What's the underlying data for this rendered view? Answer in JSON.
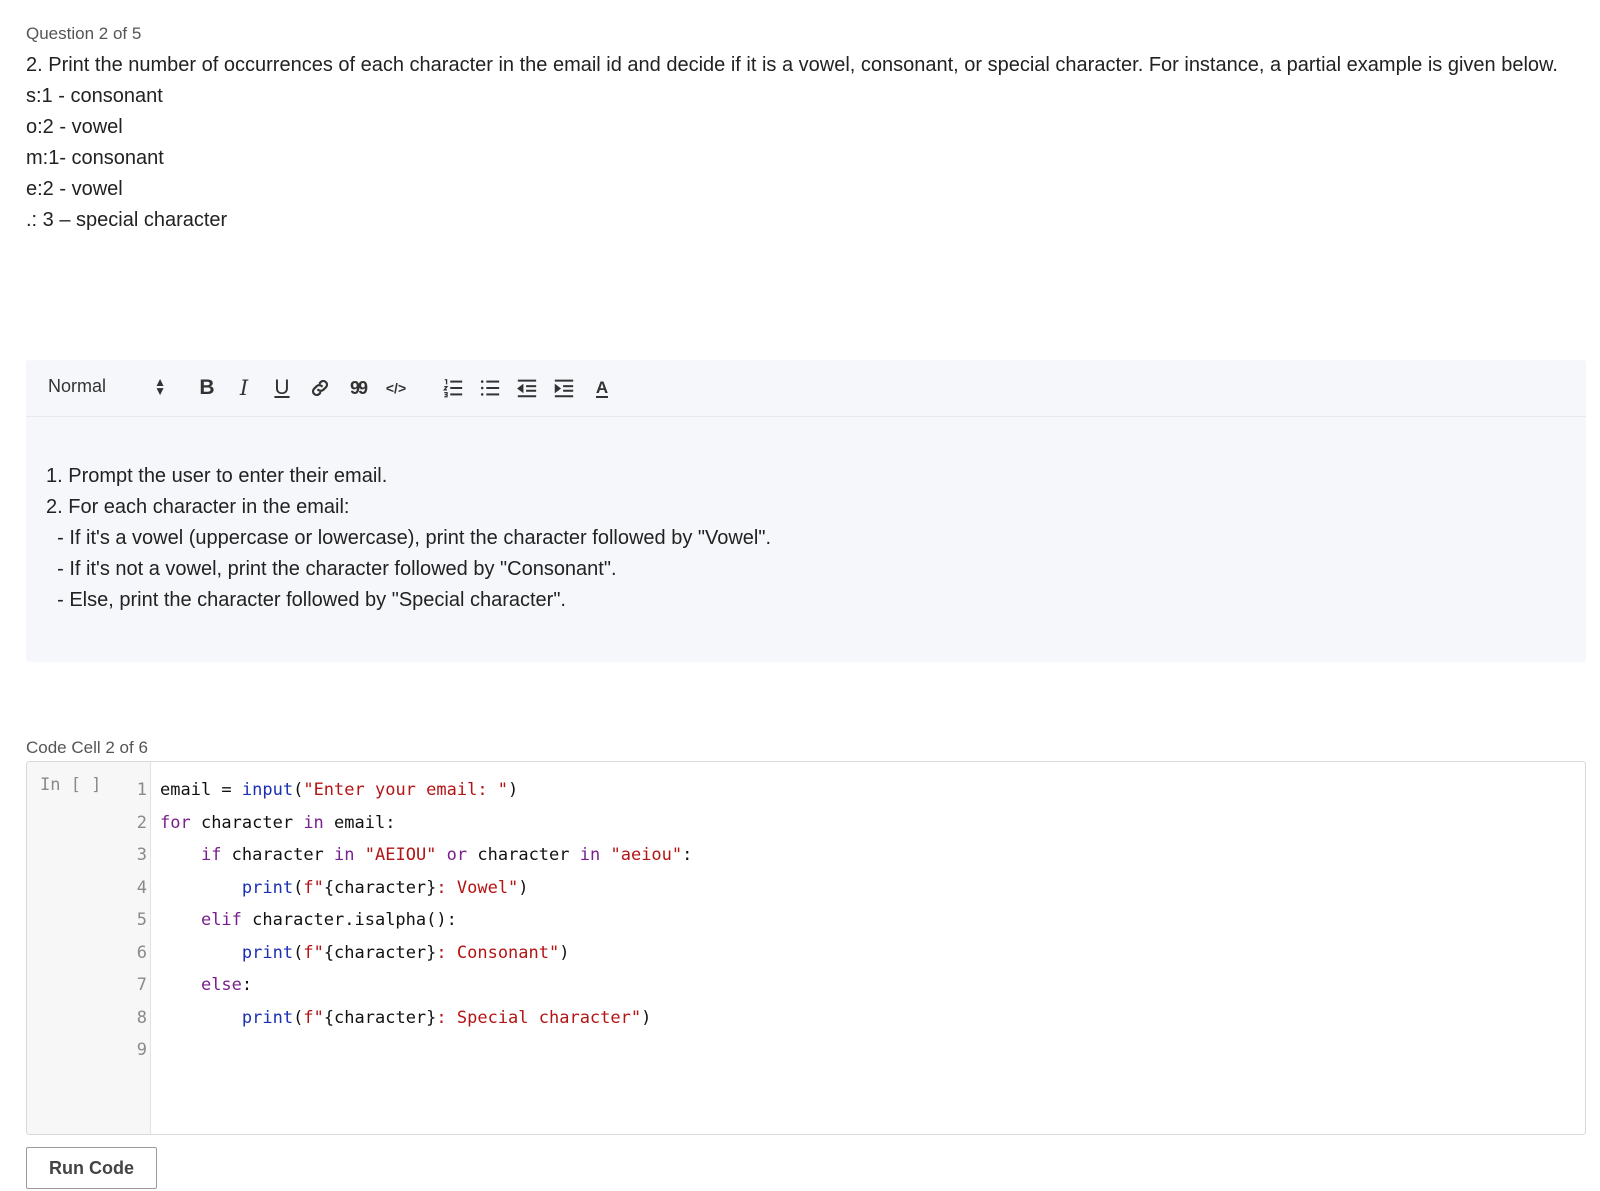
{
  "question": {
    "header": "Question 2 of 5",
    "lines": [
      "2.  Print the number of occurrences of each character in the email id and decide if it is a vowel, consonant, or special character. For instance, a partial example is given below.",
      "s:1 - consonant",
      "o:2 - vowel",
      "m:1- consonant",
      "e:2 - vowel",
      ".: 3 – special character"
    ]
  },
  "editor": {
    "format_select": "Normal",
    "toolbar_icons": [
      "bold-icon",
      "italic-icon",
      "underline-icon",
      "link-icon",
      "quote-icon",
      "code-icon",
      "ordered-list-icon",
      "bullet-list-icon",
      "outdent-icon",
      "indent-icon",
      "text-color-icon"
    ],
    "toolbar_glyphs": {
      "bold": "B",
      "italic": "I",
      "underline": "U",
      "quote": "99",
      "code": "</>",
      "color": "A"
    },
    "content": [
      "1. Prompt the user to enter their email.",
      "2. For each character in the email:",
      "  - If it's a vowel (uppercase or lowercase), print the character followed by \"Vowel\".",
      "  - If it's not a vowel, print the character followed by \"Consonant\".",
      "  - Else, print the character followed by \"Special character\"."
    ]
  },
  "code_cell": {
    "label": "Code Cell 2 of 6",
    "prompt": "In [ ]",
    "line_numbers": [
      "1",
      "2",
      "3",
      "4",
      "5",
      "6",
      "7",
      "8",
      "9"
    ],
    "lines": [
      [
        {
          "t": "email = ",
          "c": ""
        },
        {
          "t": "input",
          "c": "fn"
        },
        {
          "t": "(",
          "c": ""
        },
        {
          "t": "\"Enter your email: \"",
          "c": "str"
        },
        {
          "t": ")",
          "c": ""
        }
      ],
      [
        {
          "t": "for",
          "c": "kw"
        },
        {
          "t": " character ",
          "c": ""
        },
        {
          "t": "in",
          "c": "kw"
        },
        {
          "t": " email:",
          "c": ""
        }
      ],
      [
        {
          "t": "    ",
          "c": ""
        },
        {
          "t": "if",
          "c": "kw"
        },
        {
          "t": " character ",
          "c": ""
        },
        {
          "t": "in",
          "c": "kw"
        },
        {
          "t": " ",
          "c": ""
        },
        {
          "t": "\"AEIOU\"",
          "c": "str"
        },
        {
          "t": " ",
          "c": ""
        },
        {
          "t": "or",
          "c": "kw"
        },
        {
          "t": " character ",
          "c": ""
        },
        {
          "t": "in",
          "c": "kw"
        },
        {
          "t": " ",
          "c": ""
        },
        {
          "t": "\"aeiou\"",
          "c": "str"
        },
        {
          "t": ":",
          "c": ""
        }
      ],
      [
        {
          "t": "        ",
          "c": ""
        },
        {
          "t": "print",
          "c": "fn"
        },
        {
          "t": "(",
          "c": ""
        },
        {
          "t": "f\"",
          "c": "str"
        },
        {
          "t": "{character}",
          "c": ""
        },
        {
          "t": ": Vowel\"",
          "c": "str"
        },
        {
          "t": ")",
          "c": ""
        }
      ],
      [
        {
          "t": "    ",
          "c": ""
        },
        {
          "t": "elif",
          "c": "kw"
        },
        {
          "t": " character.isalpha():",
          "c": ""
        }
      ],
      [
        {
          "t": "        ",
          "c": ""
        },
        {
          "t": "print",
          "c": "fn"
        },
        {
          "t": "(",
          "c": ""
        },
        {
          "t": "f\"",
          "c": "str"
        },
        {
          "t": "{character}",
          "c": ""
        },
        {
          "t": ": Consonant\"",
          "c": "str"
        },
        {
          "t": ")",
          "c": ""
        }
      ],
      [
        {
          "t": "    ",
          "c": ""
        },
        {
          "t": "else",
          "c": "kw"
        },
        {
          "t": ":",
          "c": ""
        }
      ],
      [
        {
          "t": "        ",
          "c": ""
        },
        {
          "t": "print",
          "c": "fn"
        },
        {
          "t": "(",
          "c": ""
        },
        {
          "t": "f\"",
          "c": "str"
        },
        {
          "t": "{character}",
          "c": ""
        },
        {
          "t": ": Special character\"",
          "c": "str"
        },
        {
          "t": ")",
          "c": ""
        }
      ],
      [
        {
          "t": "",
          "c": ""
        }
      ]
    ]
  },
  "run_button": {
    "label": "Run Code"
  },
  "colors": {
    "editor_bg": "#f6f7fa",
    "keyword": "#7a1f8f",
    "builtin": "#1a2fb5",
    "string": "#b31414",
    "gutter_bg": "#f7f7f7"
  }
}
